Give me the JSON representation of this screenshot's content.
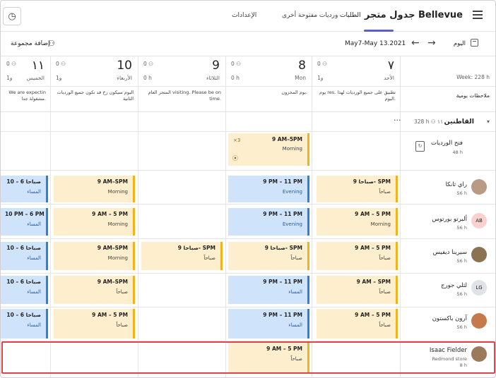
{
  "header": {
    "store_title": "جدول متجر Bellevue",
    "tabs": [
      {
        "label": "الطلبات",
        "active": true
      },
      {
        "label": "ورديات مفتوحة أخرى",
        "active": false
      },
      {
        "label": "الإعدادات",
        "active": false
      }
    ]
  },
  "toolbar": {
    "today_label": "اليوم",
    "date_range": "May7-May 13.2021",
    "add_group_label": "إضافة مجموعة"
  },
  "week_hours": "Week: 228 h",
  "days": [
    {
      "num": "٧",
      "name": "الأحد",
      "stats": "0 ⚇",
      "hours": "و1"
    },
    {
      "num": "8",
      "name": "Mon",
      "stats": "0 ⚇",
      "hours": "0 h"
    },
    {
      "num": "9",
      "name": "الثلاثاء",
      "stats": "0 ⚇",
      "hours": "0 h"
    },
    {
      "num": "10",
      "name": "الأربعاء",
      "stats": "0 ⚇",
      "hours": "و1"
    },
    {
      "num": "١١",
      "name": "الخميس",
      "stats": "0 ⚇",
      "hours": "و1"
    }
  ],
  "daily_notes": {
    "label": "ملاحظات يومية",
    "notes": [
      "يوم res. تطبيق على جميع الورديات لهذا اليوم.",
      "يوم المخزون.",
      "المتجر العام visiting. Please be on time.",
      "اليوم سيكون رخ قد نكون جميع الورديات الثانية",
      "We are expectin مشغولة جدا."
    ]
  },
  "group": {
    "name": "القاطنين",
    "stats": "328 h  ⚇ ١١"
  },
  "open_shifts": {
    "label": "فتح الورديات",
    "hours": "48 h",
    "shift": {
      "time": "9 AM–5PM",
      "label": "Morning",
      "extra": "×3"
    }
  },
  "people": [
    {
      "name": "راي ثانكا",
      "hours": "56 h",
      "initials": "",
      "avatar_color": "#b89a86"
    },
    {
      "name": "ألبرتو بورتوس",
      "hours": "56 h",
      "initials": "AB",
      "avatar_color": "#f9d1d1"
    },
    {
      "name": "سيرينا ديفيس",
      "hours": "56 h",
      "initials": "",
      "avatar_color": "#8a7350"
    },
    {
      "name": "لثلي جورج",
      "hours": "56 h",
      "initials": "LG",
      "avatar_color": "#dfe3e8"
    },
    {
      "name": "آرون باكستون",
      "hours": "56 h",
      "initials": "",
      "avatar_color": "#c47a4a"
    },
    {
      "name": "Isaac Fielder",
      "sub": "Redmond store",
      "hours": "8 h",
      "initials": "",
      "avatar_color": "#9b7a5c"
    }
  ],
  "shifts": {
    "r1": [
      {
        "time": "9 صباحا- SPM",
        "label": "صباحاً",
        "type": "morning"
      },
      {
        "time": "9 PM – 11 PM",
        "label": "Evening",
        "type": "evening"
      },
      {
        "time": "9 AM–SPM",
        "label": "Morning",
        "type": "morning"
      },
      {
        "time": "10 – 6 صباحا",
        "label": "المساء",
        "type": "evening"
      }
    ],
    "r2": [
      {
        "time": "9 AM – 5 PM",
        "label": "Morning",
        "type": "morning"
      },
      {
        "time": "9 PM – 11 PM",
        "label": "Evening",
        "type": "evening"
      },
      {
        "time": "9 AM – 5 PM",
        "label": "Morning",
        "type": "morning"
      },
      {
        "time": "10 PM – 6 PM",
        "label": "المساء",
        "type": "evening"
      }
    ],
    "r3": [
      {
        "time": "9 AM – 5 PM",
        "label": "صباحاً",
        "type": "morning"
      },
      {
        "time": "9 صباحا- SPM",
        "label": "صباحاً",
        "type": "morning"
      },
      {
        "time": "9 صباحا- SPM",
        "label": "صباحاً",
        "type": "morning"
      },
      {
        "time": "9 AM–SPM",
        "label": "Morning",
        "type": "morning"
      },
      {
        "time": "10 – 6 صباحا",
        "label": "المساء",
        "type": "evening"
      }
    ],
    "r4": [
      {
        "time": "9 AM – SPM",
        "label": "صباحاً",
        "type": "morning"
      },
      {
        "time": "9 PM – 11 PM",
        "label": "المساء",
        "type": "evening"
      },
      {
        "time": "9 AM–SPM",
        "label": "صباحاً",
        "type": "morning"
      },
      {
        "time": "10 – 6 صباحا",
        "label": "المساء",
        "type": "evening"
      }
    ],
    "r5": [
      {
        "time": "9 AM – 5 PM",
        "label": "صباحاً",
        "type": "morning"
      },
      {
        "time": "9 PM – 11 PM",
        "label": "المساء",
        "type": "evening"
      },
      {
        "time": "9 AM – 5 PM",
        "label": "صباحاً",
        "type": "morning"
      },
      {
        "time": "10 – 6 صباحا",
        "label": "المساء",
        "type": "evening"
      }
    ],
    "r6": [
      {
        "time": "9 AM – 5 PM",
        "label": "صباحاً",
        "type": "morning"
      }
    ]
  },
  "colors": {
    "accent": "#5b5fc7",
    "morning": "#f2b21b",
    "evening": "#2f7fd3",
    "highlight": "#e0444b"
  }
}
